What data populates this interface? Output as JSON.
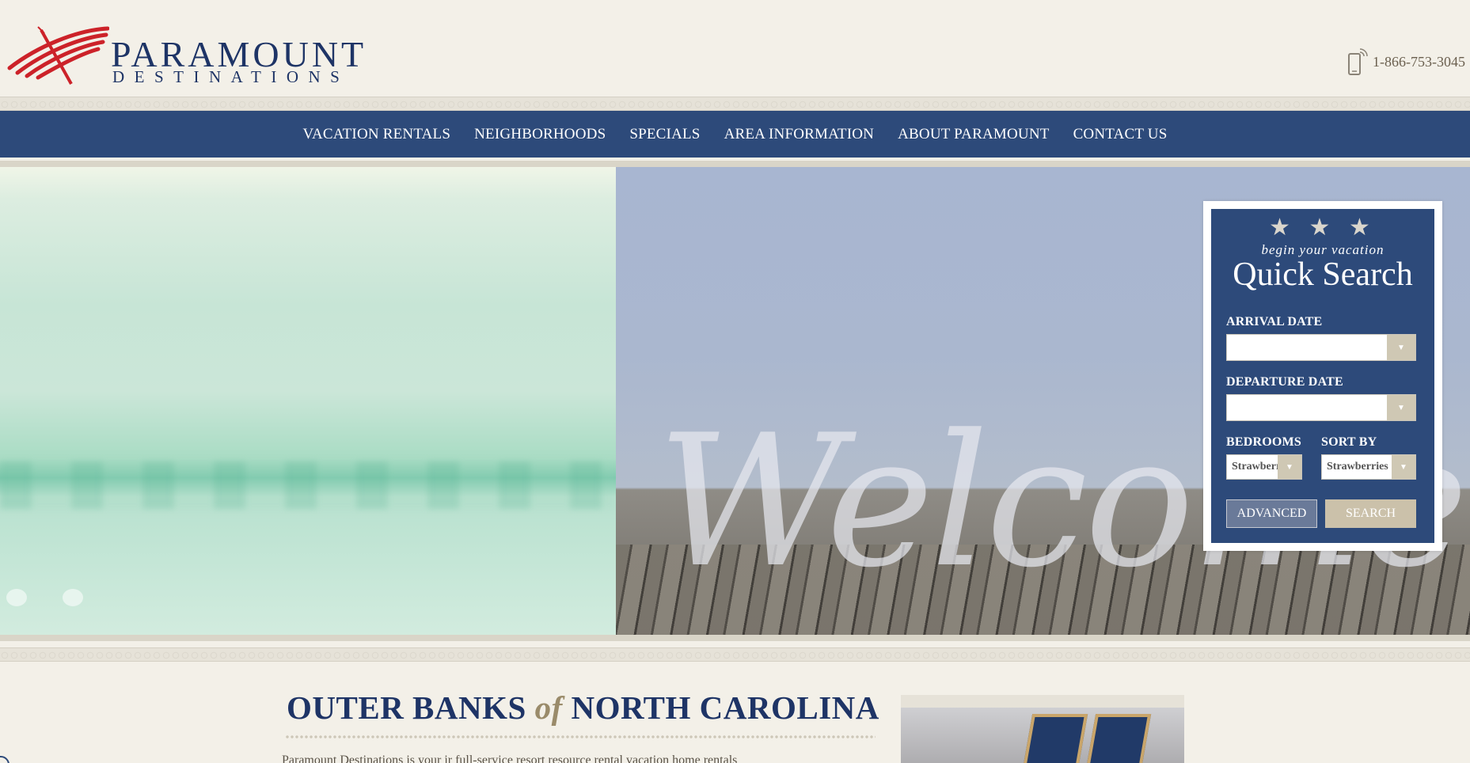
{
  "brand": {
    "name": "PARAMOUNT",
    "tagline": "DESTINATIONS",
    "logo_color": "#cc2229",
    "brand_color": "#1e3466"
  },
  "header": {
    "phone": "1-866-753-3045",
    "phone_icon": "mobile-phone-icon"
  },
  "nav": {
    "items": [
      {
        "label": "VACATION RENTALS"
      },
      {
        "label": "NEIGHBORHOODS"
      },
      {
        "label": "SPECIALS"
      },
      {
        "label": "AREA INFORMATION"
      },
      {
        "label": "ABOUT PARAMOUNT"
      },
      {
        "label": "CONTACT US"
      }
    ],
    "background": "#2d4a7a"
  },
  "hero": {
    "overlay_text": "Welcome",
    "slide_count": 2
  },
  "quick_search": {
    "stars": "★ ★ ★",
    "subtitle": "begin your vacation",
    "title": "Quick Search",
    "arrival_label": "ARRIVAL DATE",
    "arrival_value": "",
    "departure_label": "DEPARTURE DATE",
    "departure_value": "",
    "bedrooms_label": "BEDROOMS",
    "bedrooms_value": "Strawberries",
    "sortby_label": "SORT BY",
    "sortby_value": "Strawberries",
    "advanced_button": "ADVANCED",
    "search_button": "SEARCH"
  },
  "content": {
    "title_part1": "OUTER BANKS",
    "title_of": "of",
    "title_part2": "NORTH CAROLINA",
    "intro": "Paramount Destinations is your ir full-service resort resource rental vacation home rentals"
  }
}
